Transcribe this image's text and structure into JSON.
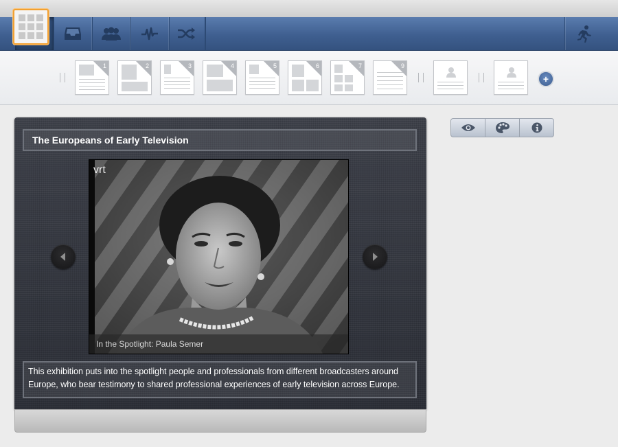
{
  "nav": {
    "left_items": [
      {
        "icon": "gear-icon",
        "active": true
      },
      {
        "icon": "inbox-tray-icon",
        "active": false
      },
      {
        "icon": "users-icon",
        "active": false
      },
      {
        "icon": "activity-pulse-icon",
        "active": false
      },
      {
        "icon": "shuffle-icon",
        "active": false
      }
    ],
    "right_items": [
      {
        "icon": "running-person-icon"
      }
    ],
    "colors": {
      "bar": "#3f5f90",
      "active_icon": "#5bb6ff"
    }
  },
  "layouts": {
    "grid_selected": true,
    "numbered": [
      "1",
      "2",
      "3",
      "4",
      "5",
      "6",
      "7",
      "9"
    ],
    "person_layouts": 2,
    "add_label": "+"
  },
  "exhibition": {
    "title": "The Europeans of Early Television",
    "video_logo": "vrt",
    "video_caption": "In the Spotlight: Paula Semer",
    "description": "This exhibition puts into the spotlight people and professionals from different broadcasters around Europe, who bear testimony to shared professional experiences of early television across Europe."
  },
  "side_controls": [
    {
      "icon": "eye-icon"
    },
    {
      "icon": "palette-icon"
    },
    {
      "icon": "info-icon"
    }
  ]
}
